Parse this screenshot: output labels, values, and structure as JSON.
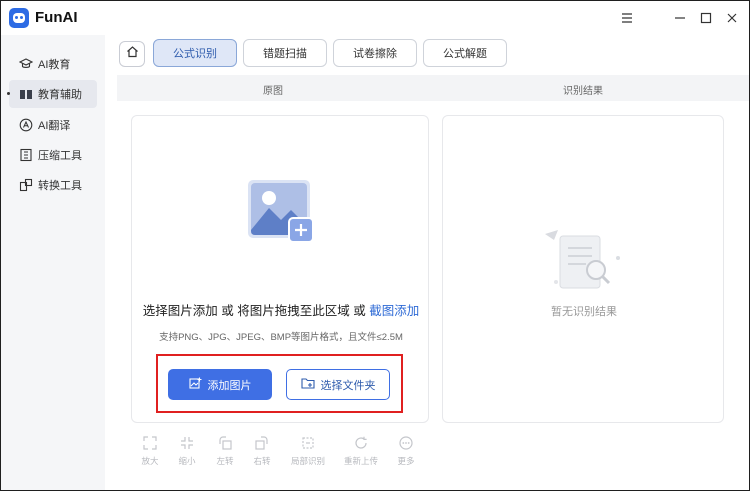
{
  "app": {
    "title": "FunAI"
  },
  "sidebar": {
    "items": [
      {
        "label": "AI教育",
        "icon": "graduation-cap-icon"
      },
      {
        "label": "教育辅助",
        "icon": "book-icon",
        "active": true
      },
      {
        "label": "AI翻译",
        "icon": "translate-icon"
      },
      {
        "label": "压缩工具",
        "icon": "compress-icon"
      },
      {
        "label": "转换工具",
        "icon": "convert-icon"
      }
    ]
  },
  "tabs": [
    {
      "label": "公式识别",
      "active": true
    },
    {
      "label": "错题扫描"
    },
    {
      "label": "试卷擦除"
    },
    {
      "label": "公式解题"
    }
  ],
  "headers": {
    "left": "原图",
    "right": "识别结果"
  },
  "upload": {
    "main_text_prefix": "选择图片添加 或 将图片拖拽至此区域 或 ",
    "main_text_link": "截图添加",
    "sub_text": "支持PNG、JPG、JPEG、BMP等图片格式，且文件≤2.5M",
    "add_button": "添加图片",
    "folder_button": "选择文件夹"
  },
  "result": {
    "empty_text": "暂无识别结果"
  },
  "toolbar": [
    {
      "label": "放大",
      "icon": "zoom-in-icon"
    },
    {
      "label": "缩小",
      "icon": "zoom-out-icon"
    },
    {
      "label": "左转",
      "icon": "rotate-left-icon"
    },
    {
      "label": "右转",
      "icon": "rotate-right-icon"
    },
    {
      "label": "局部识别",
      "icon": "partial-recognize-icon"
    },
    {
      "label": "重新上传",
      "icon": "reupload-icon"
    },
    {
      "label": "更多",
      "icon": "more-icon"
    }
  ],
  "colors": {
    "accent": "#3f6fe4",
    "highlight_box": "#e02020"
  }
}
